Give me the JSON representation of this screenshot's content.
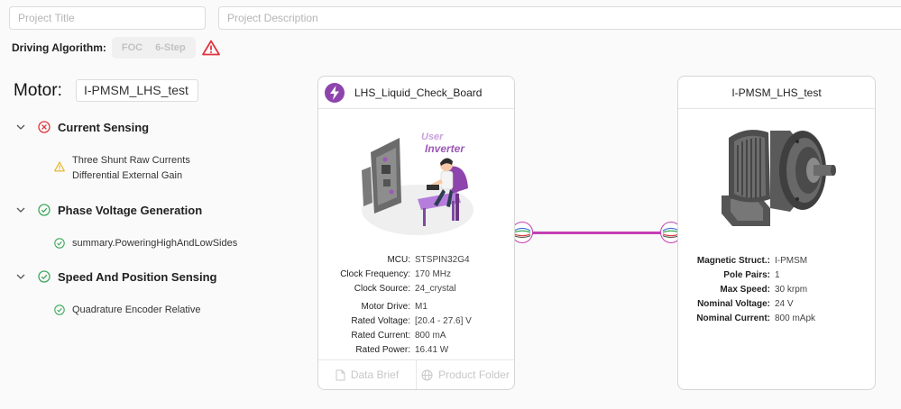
{
  "header": {
    "title_placeholder": "Project Title",
    "description_placeholder": "Project Description"
  },
  "algorithm": {
    "label": "Driving Algorithm:",
    "options": [
      "FOC",
      "6-Step"
    ],
    "warning_icon": "warning-triangle-icon"
  },
  "motor": {
    "label": "Motor:",
    "name": "I-PMSM_LHS_test"
  },
  "sections": [
    {
      "title": "Current Sensing",
      "status": "error",
      "items": [
        {
          "status": "warning",
          "lines": [
            "Three Shunt Raw Currents",
            "Differential External Gain"
          ]
        }
      ]
    },
    {
      "title": "Phase Voltage Generation",
      "status": "ok",
      "items": [
        {
          "status": "ok",
          "lines": [
            "summary.PoweringHighAndLowSides"
          ]
        }
      ]
    },
    {
      "title": "Speed And Position Sensing",
      "status": "ok",
      "items": [
        {
          "status": "ok",
          "lines": [
            "Quadrature Encoder Relative"
          ]
        }
      ]
    }
  ],
  "board": {
    "title": "LHS_Liquid_Check_Board",
    "illustration_text": [
      "User",
      "Inverter"
    ],
    "specs_a": [
      {
        "k": "MCU:",
        "v": "STSPIN32G4"
      },
      {
        "k": "Clock Frequency:",
        "v": "170 MHz"
      },
      {
        "k": "Clock Source:",
        "v": "24_crystal"
      }
    ],
    "specs_b": [
      {
        "k": "Motor Drive:",
        "v": "M1"
      },
      {
        "k": "Rated Voltage:",
        "v": "[20.4 - 27.6] V"
      },
      {
        "k": "Rated Current:",
        "v": "800 mA"
      },
      {
        "k": "Rated Power:",
        "v": "16.41 W"
      }
    ],
    "footer": [
      "Data Brief",
      "Product Folder"
    ]
  },
  "motor_card": {
    "title": "I-PMSM_LHS_test",
    "specs": [
      {
        "k": "Magnetic Struct.:",
        "v": "I-PMSM"
      },
      {
        "k": "Pole Pairs:",
        "v": "1"
      },
      {
        "k": "Max Speed:",
        "v": "30 krpm"
      },
      {
        "k": "Nominal Voltage:",
        "v": "24 V"
      },
      {
        "k": "Nominal Current:",
        "v": "800 mApk"
      }
    ]
  },
  "colors": {
    "accent": "#c43fb4",
    "error": "#e0353d",
    "ok": "#3daa5c",
    "warning": "#e8b21b"
  }
}
